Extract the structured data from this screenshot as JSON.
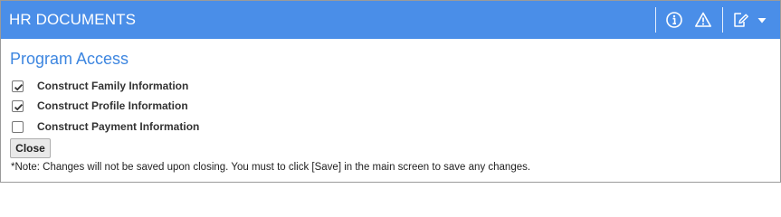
{
  "header": {
    "title": "HR DOCUMENTS",
    "icons": [
      "info-icon",
      "warning-icon",
      "edit-document-icon",
      "caret-down-icon"
    ],
    "background": "#4a8ee8"
  },
  "main": {
    "section_title": "Program Access",
    "section_title_color": "#3d86e0",
    "options": [
      {
        "label": "Construct Family Information",
        "checked": true
      },
      {
        "label": "Construct Profile Information",
        "checked": true
      },
      {
        "label": "Construct Payment Information",
        "checked": false
      }
    ],
    "close_label": "Close",
    "note": "*Note: Changes will not be saved upon closing. You must to click [Save] in the main screen to save any changes."
  }
}
